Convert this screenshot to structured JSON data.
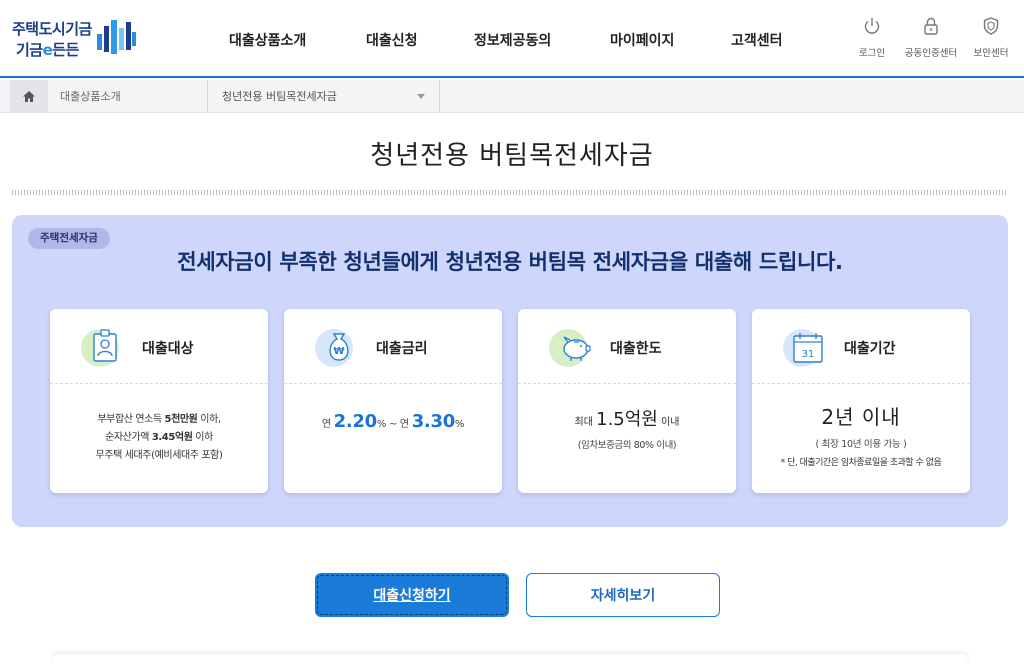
{
  "logo": {
    "line1": "주택도시기금",
    "line2_prefix": "기금",
    "line2_e": "e",
    "line2_suffix": "든든"
  },
  "gnb": [
    "대출상품소개",
    "대출신청",
    "정보제공동의",
    "마이페이지",
    "고객센터"
  ],
  "util": [
    {
      "label": "로그인",
      "icon": "power-icon"
    },
    {
      "label": "공동인증센터",
      "icon": "lock-icon"
    },
    {
      "label": "보안센터",
      "icon": "shield-icon"
    }
  ],
  "breadcrumb": {
    "home_icon": "home-icon",
    "level1": "대출상품소개",
    "level2": "청년전용 버팀목전세자금"
  },
  "page_title": "청년전용 버팀목전세자금",
  "panel": {
    "badge": "주택전세자금",
    "headline": "전세자금이 부족한 청년들에게 청년전용 버팀목 전세자금을 대출해 드립니다.",
    "cards": {
      "target": {
        "title": "대출대상",
        "icon": "id-badge-icon",
        "line1_pre": "부부합산 연소득 ",
        "line1_bold": "5천만원",
        "line1_post": " 이하,",
        "line2_pre": "순자산가액 ",
        "line2_bold": "3.45억원",
        "line2_post": " 이하",
        "line3": "무주택 세대주(예비세대주 포함)"
      },
      "rate": {
        "title": "대출금리",
        "icon": "money-bag-icon",
        "pre": "연 ",
        "low": "2.20",
        "pct": "%",
        "tilde": " ~ 연 ",
        "high": "3.30"
      },
      "limit": {
        "title": "대출한도",
        "icon": "piggy-bank-icon",
        "pre": "최대 ",
        "amount": "1.5억원",
        "post": " 이내",
        "sub": "(임차보증금의 80% 이내)"
      },
      "period": {
        "title": "대출기간",
        "icon": "calendar-icon",
        "calendar_day": "31",
        "main": "2년 이내",
        "sub": "( 최장 10년 이용 가능 )",
        "note": "* 단, 대출기간은 임차종료일을 초과할 수 없음"
      }
    }
  },
  "buttons": {
    "apply": "대출신청하기",
    "detail": "자세히보기"
  },
  "colors": {
    "accent": "#1a7bd9",
    "panel_bg": "#cfd6fb",
    "navy": "#12306e"
  }
}
